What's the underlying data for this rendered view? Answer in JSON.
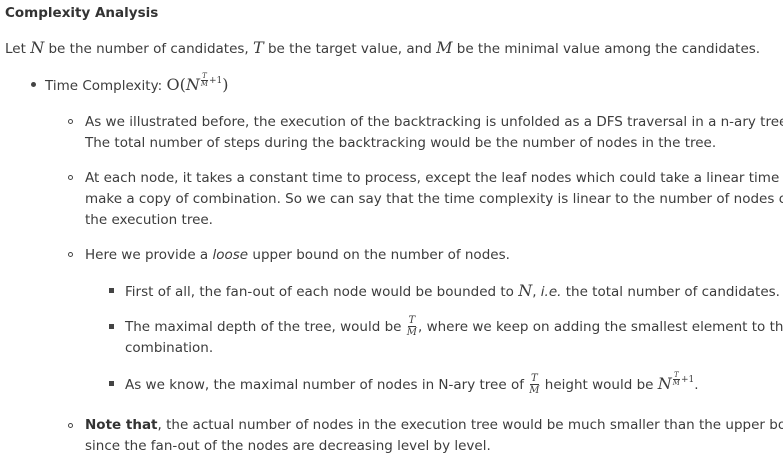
{
  "heading": "Complexity Analysis",
  "intro": {
    "let": "Let ",
    "N": "N",
    "t1": " be the number of candidates, ",
    "T": "T",
    "t2": " be the target value, and ",
    "M": "M",
    "t3": " be the minimal value among the candidates."
  },
  "time": {
    "label": "Time Complexity: ",
    "O": "O",
    "open": "(",
    "N": "N",
    "fracNum": "T",
    "fracDen": "M",
    "plus1": "+1",
    "close": ")"
  },
  "p1": {
    "line1": "As we illustrated before, the execution of the backtracking is unfolded as a DFS traversal in a n-ary tree.",
    "line2": "The total number of steps during the backtracking would be the number of nodes in the tree."
  },
  "p2": {
    "line1": "At each node, it takes a constant time to process, except the leaf nodes which could take a linear time to",
    "line2": "make a copy of combination. So we can say that the time complexity is linear to the number of nodes of",
    "line3": "the execution tree."
  },
  "p3": {
    "pre": "Here we provide a ",
    "em": "loose",
    "post": " upper bound on the number of nodes."
  },
  "s1": {
    "pre": "First of all, the fan-out of each node would be bounded to ",
    "N": "N",
    "comma": ", ",
    "ie": "i.e.",
    "post": " the total number of candidates."
  },
  "s2": {
    "pre": "The maximal depth of the tree, would be ",
    "fracNum": "T",
    "fracDen": "M",
    "post": ", where we keep on adding the smallest element to the",
    "line2": "combination."
  },
  "s3": {
    "pre": "As we know, the maximal number of nodes in N-ary tree of ",
    "fracNum": "T",
    "fracDen": "M",
    "mid": " height would be ",
    "N": "N",
    "expNum": "T",
    "expDen": "M",
    "plus1": "+1",
    "end": "."
  },
  "p4": {
    "bold": "Note that",
    "line1": ", the actual number of nodes in the execution tree would be much smaller than the upper bound,",
    "line2": "since the fan-out of the nodes are decreasing level by level."
  }
}
